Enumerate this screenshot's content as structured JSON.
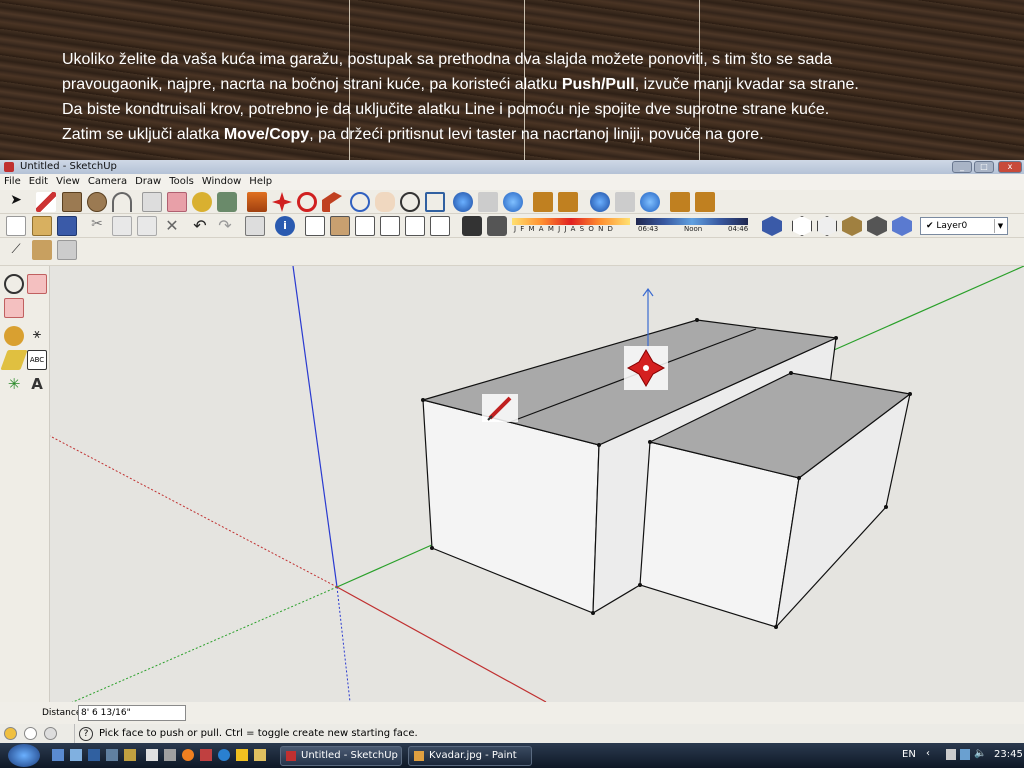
{
  "slide": {
    "line1": "Ukoliko želite da vaša kuća ima garažu, postupak sa prethodna dva slajda možete ponoviti, s tim što se sada",
    "line2_pre": "pravougaonik, najpre, nacrta na bočnoj strani kuće, pa koristeći alatku ",
    "line2_bold": "Push/Pull",
    "line2_post": ", izvuče manji kvadar sa strane.",
    "line3": "Da biste kondtruisali krov, potrebno je da uključite alatku Line i pomoću nje spojite dve suprotne strane kuće.",
    "line4_pre": "Zatim se uključi alatka ",
    "line4_bold": "Move/Copy",
    "line4_post": ", pa držeći pritisnut levi taster na nacrtanoj liniji, povuče na gore."
  },
  "window": {
    "title": "Untitled - SketchUp"
  },
  "menu": [
    "File",
    "Edit",
    "View",
    "Camera",
    "Draw",
    "Tools",
    "Window",
    "Help"
  ],
  "shadow_bar": {
    "months": "J F M A M J J A S O N D",
    "time_start": "06:43",
    "time_mid": "Noon",
    "time_end": "04:46"
  },
  "layer": {
    "current": "Layer0"
  },
  "vcu": {
    "label": "Distance",
    "value": "8' 6 13/16\""
  },
  "status": {
    "hint": "Pick face to push or pull.  Ctrl = toggle create new starting face."
  },
  "taskbar": {
    "tasks": [
      "Untitled - SketchUp",
      "Kvadar.jpg - Paint"
    ],
    "lang": "EN",
    "clock": "23:45"
  },
  "colors": {
    "axis_red": "#c03030",
    "axis_green": "#2aa02a",
    "axis_blue": "#2a3ad0",
    "face_light": "#f4f4f4",
    "face_roof": "#a9a9a9"
  }
}
